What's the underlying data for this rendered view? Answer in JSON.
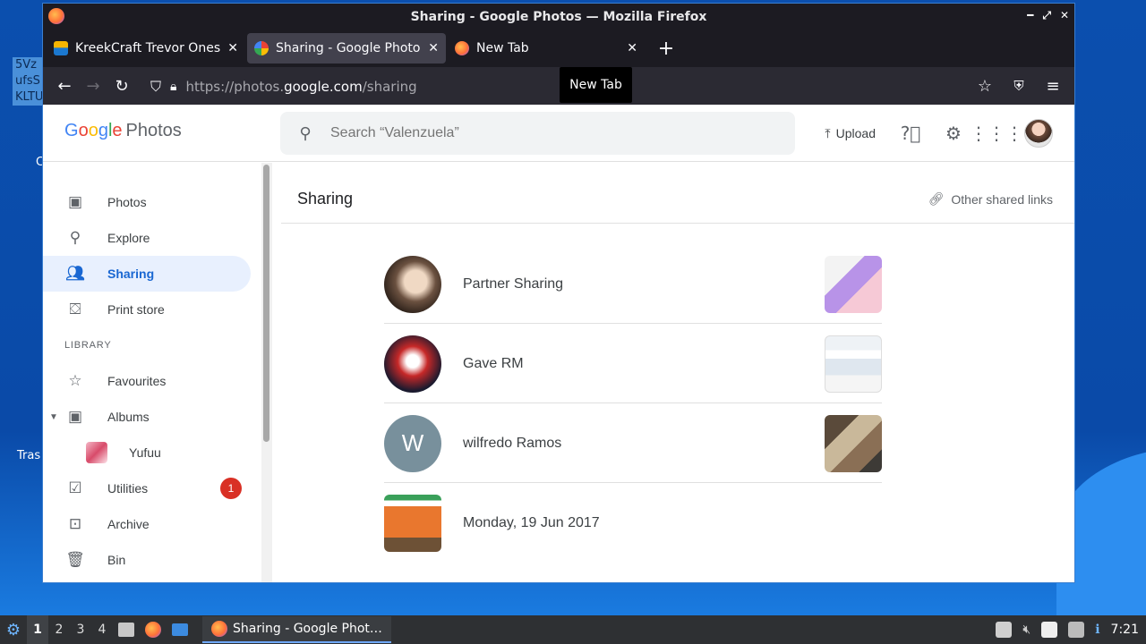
{
  "desktop": {
    "selected_label": "5Vz ufsS KLTU",
    "trash_label": "Tras"
  },
  "window": {
    "title": "Sharing - Google Photos — Mozilla Firefox"
  },
  "tabs": [
    {
      "title": "KreekCraft Trevor Onesie",
      "active": false
    },
    {
      "title": "Sharing - Google Photos",
      "active": true
    },
    {
      "title": "New Tab",
      "active": false
    }
  ],
  "tooltip": "New Tab",
  "urlbar": {
    "prefix": "https://photos.",
    "host": "google.com",
    "path": "/sharing"
  },
  "gphotos": {
    "logo_word": "Google",
    "logo_suffix": "Photos",
    "search_placeholder": "Search “Valenzuela”",
    "upload_label": "Upload"
  },
  "sidebar": {
    "items": [
      {
        "label": "Photos",
        "icon": "photo-icon"
      },
      {
        "label": "Explore",
        "icon": "search-icon"
      },
      {
        "label": "Sharing",
        "icon": "people-icon",
        "active": true
      },
      {
        "label": "Print store",
        "icon": "bag-icon"
      }
    ],
    "library_label": "LIBRARY",
    "library": [
      {
        "label": "Favourites",
        "icon": "star-icon"
      },
      {
        "label": "Albums",
        "icon": "album-icon"
      },
      {
        "label": "Yufuu",
        "icon": "album-thumb"
      },
      {
        "label": "Utilities",
        "icon": "checklist-icon",
        "badge": "1"
      },
      {
        "label": "Archive",
        "icon": "archive-icon"
      },
      {
        "label": "Bin",
        "icon": "trash-icon"
      }
    ]
  },
  "main": {
    "title": "Sharing",
    "other_links": "Other shared links",
    "shares": [
      {
        "name": "Partner Sharing"
      },
      {
        "name": "Gave RM"
      },
      {
        "name": "wilfredo Ramos",
        "initial": "W"
      },
      {
        "name": "Monday, 19 Jun 2017"
      }
    ]
  },
  "taskbar": {
    "workspaces": [
      "1",
      "2",
      "3",
      "4"
    ],
    "active_app": "Sharing - Google Phot…",
    "clock": "7:21"
  }
}
